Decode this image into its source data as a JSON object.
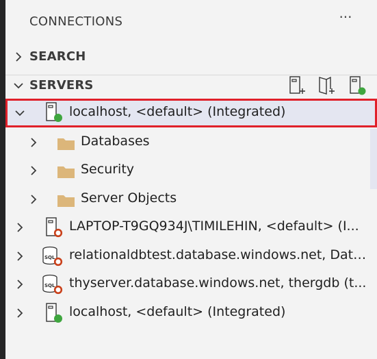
{
  "panel": {
    "title": "CONNECTIONS",
    "more_label": "···"
  },
  "sections": {
    "search": {
      "label": "SEARCH"
    },
    "servers": {
      "label": "SERVERS"
    }
  },
  "tree": {
    "root_selected": {
      "label": "localhost, <default> (Integrated)",
      "status": "connected",
      "status_color": "#3fa63f"
    },
    "children": [
      {
        "label": "Databases"
      },
      {
        "label": "Security"
      },
      {
        "label": "Server Objects"
      }
    ],
    "servers": [
      {
        "label": "LAPTOP-T9GQ934J\\TIMILEHIN, <default> (I...",
        "type": "server",
        "status": "disconnected"
      },
      {
        "label": "relationaldbtest.database.windows.net, Data...",
        "type": "sql-database",
        "status": "disconnected"
      },
      {
        "label": "thyserver.database.windows.net, thergdb (t...",
        "type": "sql-database",
        "status": "disconnected"
      },
      {
        "label": "localhost, <default> (Integrated)",
        "type": "server",
        "status": "connected"
      }
    ]
  },
  "colors": {
    "selection_border": "#e0202a",
    "selection_bg": "#e4e6f1",
    "folder": "#dcb67a",
    "connected": "#3fa63f",
    "disconnected": "#c9401a"
  }
}
